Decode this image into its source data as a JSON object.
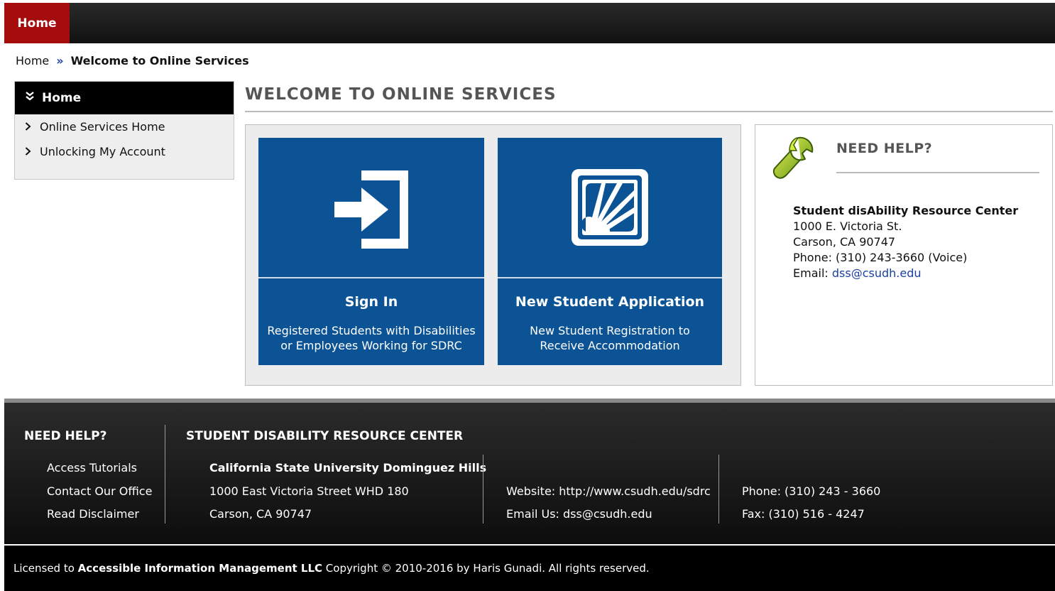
{
  "nav": {
    "home_tab": "Home"
  },
  "breadcrumb": {
    "home": "Home",
    "separator": "»",
    "current": "Welcome to Online Services"
  },
  "sidebar": {
    "header": "Home",
    "items": [
      {
        "label": "Online Services Home"
      },
      {
        "label": "Unlocking My Account"
      }
    ]
  },
  "main": {
    "title": "WELCOME TO ONLINE SERVICES",
    "tiles": [
      {
        "title": "Sign In",
        "desc_line1": "Registered Students with Disabilities",
        "desc_line2": "or Employees Working for SDRC",
        "icon": "sign-in-icon"
      },
      {
        "title": "New Student Application",
        "desc_line1": "New Student Registration to",
        "desc_line2": "Receive Accommodation",
        "icon": "application-icon"
      }
    ]
  },
  "help": {
    "title": "NEED HELP?",
    "org": "Student disAbility Resource Center",
    "address1": "1000 E. Victoria St.",
    "address2": "Carson, CA 90747",
    "phone": "Phone: (310) 243-3660 (Voice)",
    "email_label": "Email: ",
    "email": "dss@csudh.edu"
  },
  "footer": {
    "help_heading": "NEED HELP?",
    "links": [
      "Access Tutorials",
      "Contact Our Office",
      "Read Disclaimer"
    ],
    "sdrc_heading": "STUDENT DISABILITY RESOURCE CENTER",
    "university": "California State University Dominguez Hills",
    "street": "1000 East Victoria Street WHD 180",
    "city": "Carson, CA 90747",
    "website": "Website: http://www.csudh.edu/sdrc",
    "email": "Email Us: dss@csudh.edu",
    "phone": "Phone: (310) 243 - 3660",
    "fax": "Fax: (310) 516 - 4247"
  },
  "license": {
    "prefix": "Licensed to ",
    "company": "Accessible Information Management LLC",
    "suffix": " Copyright © 2010-2016 by Haris Gunadi. All rights reserved."
  },
  "colors": {
    "accent_red": "#a50d0d",
    "tile_blue": "#0b5394",
    "link_blue": "#1b3fa0"
  }
}
